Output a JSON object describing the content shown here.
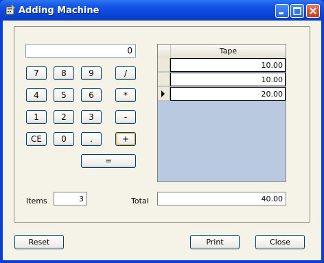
{
  "window": {
    "title": "Adding Machine",
    "icon": "calculator-app-icon",
    "controls": [
      "minimize-icon",
      "maximize-icon",
      "close-icon"
    ]
  },
  "display": {
    "value": "0"
  },
  "keypad": {
    "row1": [
      "7",
      "8",
      "9",
      "/"
    ],
    "row2": [
      "4",
      "5",
      "6",
      "*"
    ],
    "row3": [
      "1",
      "2",
      "3",
      "-"
    ],
    "row4": [
      "CE",
      "0",
      ".",
      "+"
    ],
    "equals": "="
  },
  "tape": {
    "header": "Tape",
    "rows": [
      "10.00",
      "10.00",
      "20.00"
    ]
  },
  "items": {
    "label": "Items",
    "value": "3"
  },
  "total": {
    "label": "Total",
    "value": "40.00"
  },
  "buttons": {
    "reset": "Reset",
    "print": "Print",
    "close": "Close"
  },
  "colors": {
    "titlebar": "#0a45d8",
    "face": "#f5f2e8",
    "tape_background": "#b9c9df"
  }
}
